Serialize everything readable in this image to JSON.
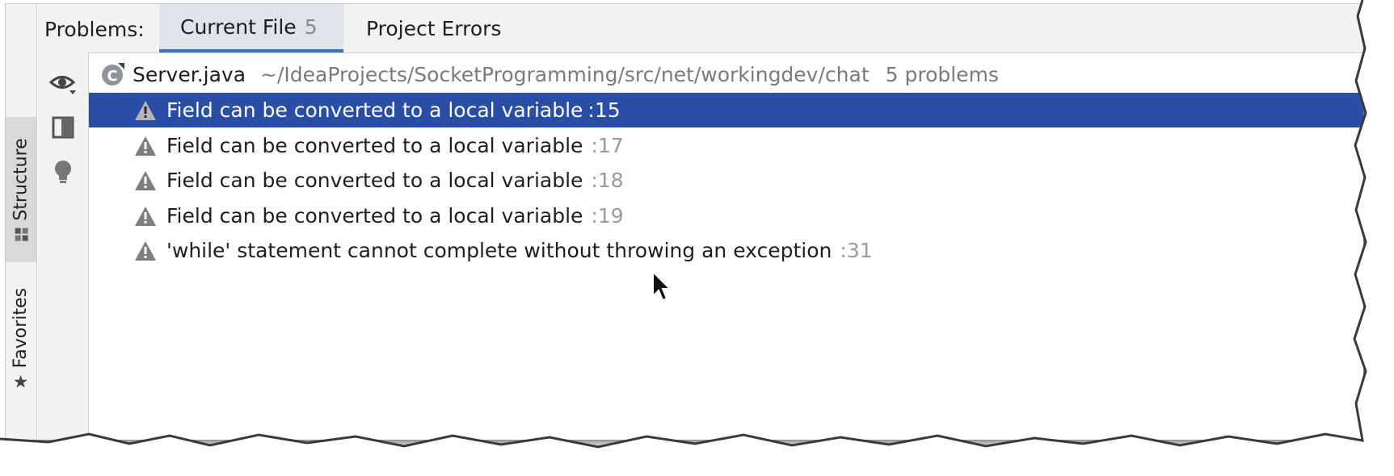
{
  "header": {
    "title": "Problems:",
    "tabs": [
      {
        "label": "Current File",
        "count": "5"
      },
      {
        "label": "Project Errors",
        "count": ""
      }
    ]
  },
  "side_tabs": {
    "structure": "Structure",
    "favorites": "Favorites"
  },
  "tools": [
    "eye-icon",
    "preview-panel-icon",
    "lightbulb-icon"
  ],
  "file": {
    "name": "Server.java",
    "path": "~/IdeaProjects/SocketProgramming/src/net/workingdev/chat",
    "count": "5 problems"
  },
  "problems": [
    {
      "message": "Field can be converted to a local variable",
      "line": ":15"
    },
    {
      "message": "Field can be converted to a local variable",
      "line": ":17"
    },
    {
      "message": "Field can be converted to a local variable",
      "line": ":18"
    },
    {
      "message": "Field can be converted to a local variable",
      "line": ":19"
    },
    {
      "message": "'while' statement cannot complete without throwing an exception",
      "line": ":31"
    }
  ],
  "colors": {
    "selection": "#2a4ea6",
    "active_tab_underline": "#3d6fc2",
    "panel_bg": "#f2f2f2"
  }
}
